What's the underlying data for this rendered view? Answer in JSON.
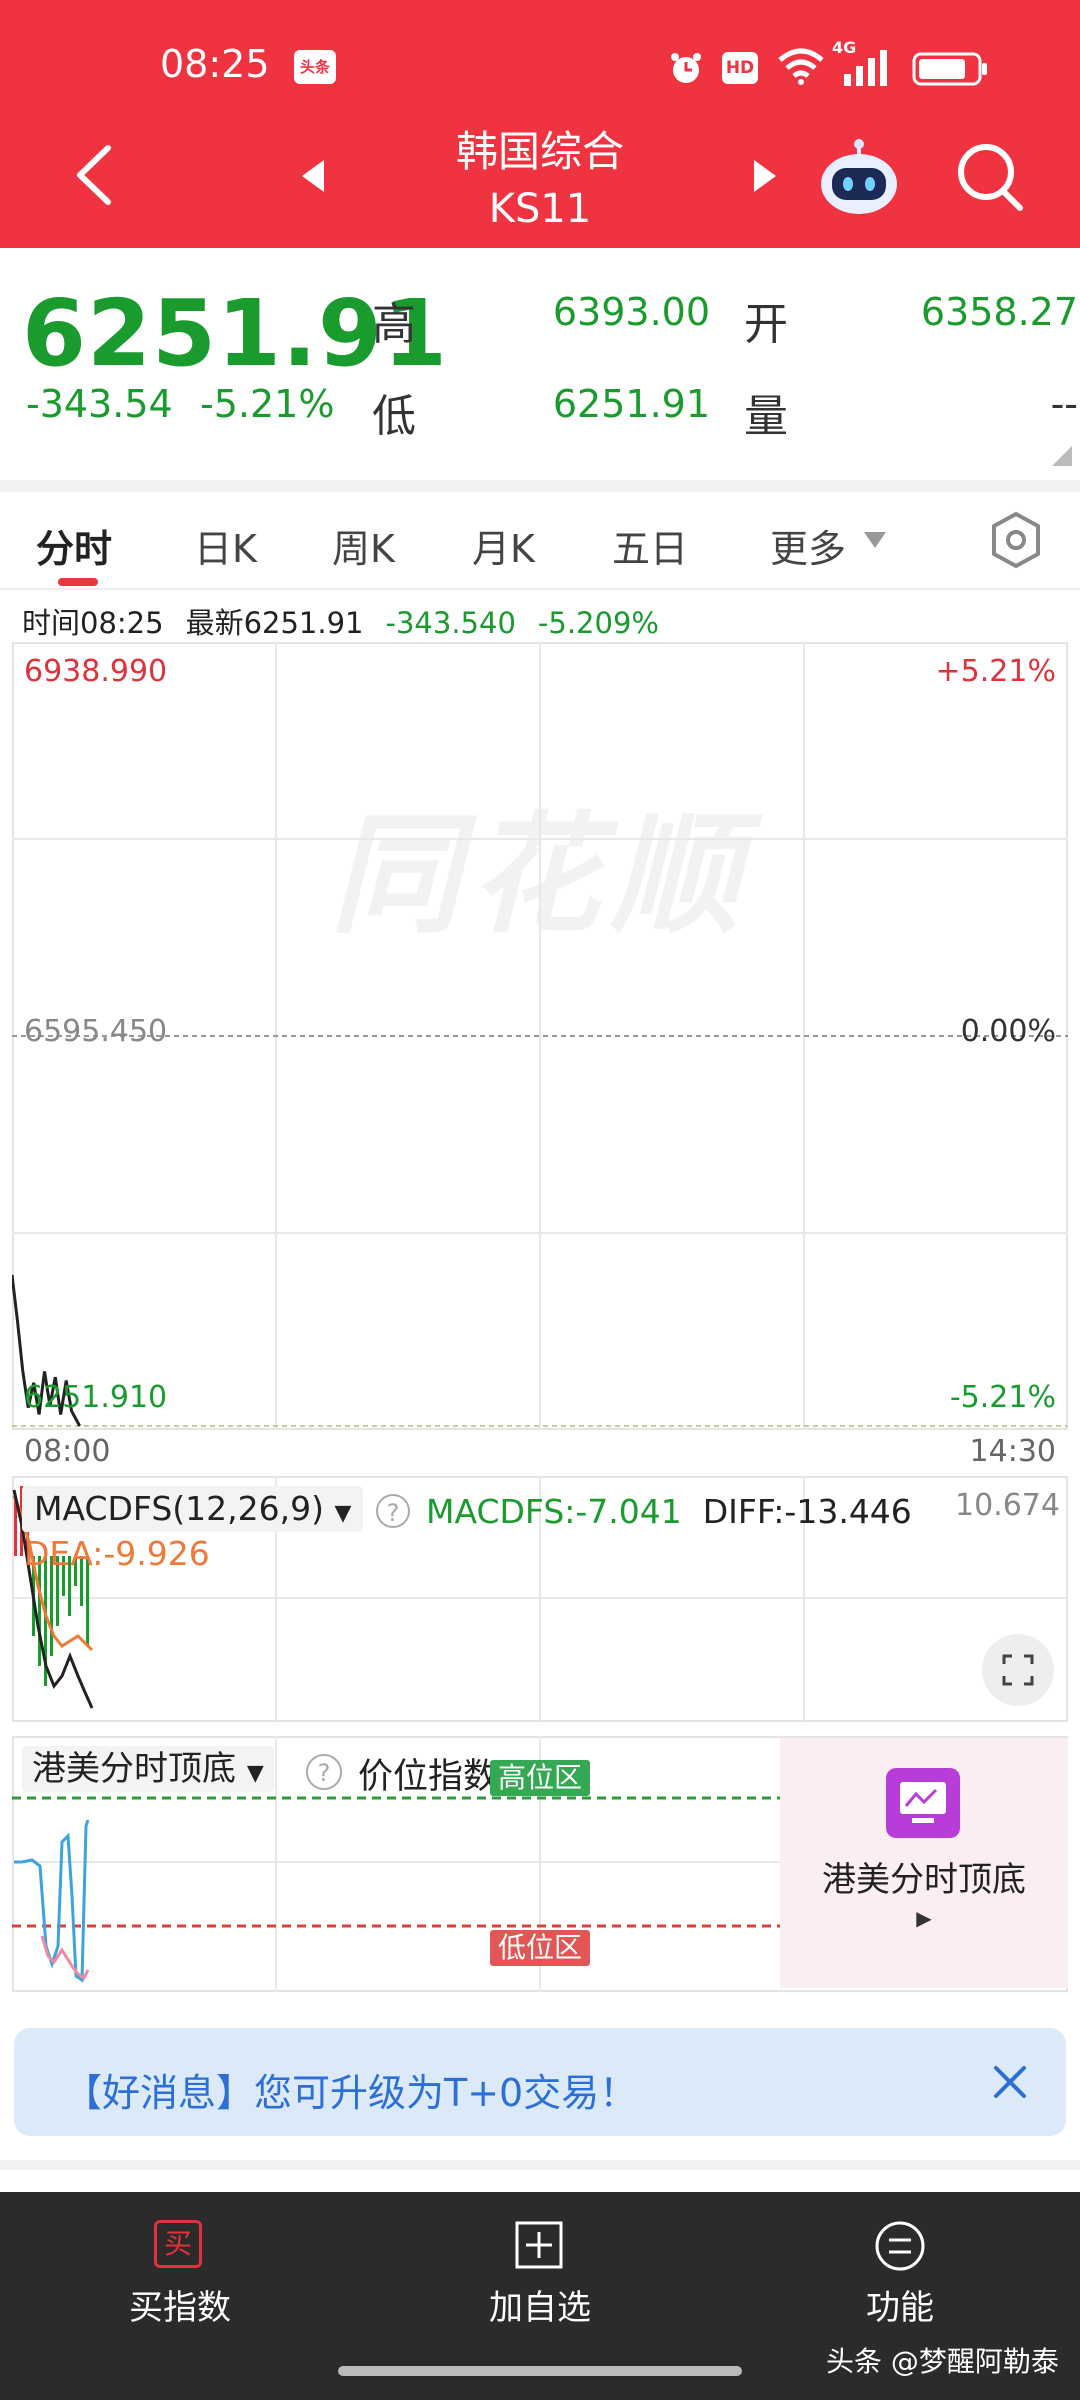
{
  "status_bar": {
    "time": "08:25",
    "badge": "头条",
    "hd": "HD",
    "network": "4G"
  },
  "header": {
    "index_name": "韩国综合",
    "index_code": "KS11"
  },
  "quote": {
    "price": "6251.91",
    "change": "-343.54",
    "change_pct": "-5.21%",
    "high_label": "高",
    "high": "6393.00",
    "open_label": "开",
    "open": "6358.27",
    "low_label": "低",
    "low": "6251.91",
    "volume_label": "量",
    "volume": "--"
  },
  "tabs": [
    "分时",
    "日K",
    "周K",
    "月K",
    "五日",
    "更多"
  ],
  "info_line": {
    "time": "时间08:25",
    "latest": "最新6251.91",
    "change": "-343.540",
    "change_pct": "-5.209%"
  },
  "chart": {
    "top_price": "6938.990",
    "top_pct": "+5.21%",
    "mid_price": "6595.450",
    "mid_pct": "0.00%",
    "bottom_price": "6251.910",
    "bottom_pct": "-5.21%",
    "start_time": "08:00",
    "end_time": "14:30",
    "watermark": "同花顺"
  },
  "chart_data": {
    "type": "line",
    "title": "",
    "x": [
      "08:00",
      "08:02",
      "08:04",
      "08:06",
      "08:08",
      "08:10",
      "08:12",
      "08:14",
      "08:16",
      "08:18",
      "08:20",
      "08:22",
      "08:25"
    ],
    "series": [
      {
        "values": [
          6385,
          6345,
          6300,
          6268,
          6290,
          6262,
          6300,
          6270,
          6295,
          6262,
          6292,
          6265,
          6251.91
        ]
      }
    ],
    "ylim": [
      6251.91,
      6938.99
    ],
    "xlim": [
      "08:00",
      "14:30"
    ],
    "grid": true
  },
  "macd": {
    "name": "MACDFS(12,26,9)",
    "macdfs": "MACDFS:-7.041",
    "diff": "DIFF:-13.446",
    "dea": "DEA:-9.926",
    "max": "10.674"
  },
  "indicator3": {
    "name": "港美分时顶底",
    "label": "价位指数:3.85",
    "high_zone": "高位区",
    "low_zone": "低位区"
  },
  "promo": {
    "title": "港美分时顶底"
  },
  "banner": {
    "text": "【好消息】您可升级为T+0交易！"
  },
  "bottom_nav": {
    "buy_icon": "买",
    "buy": "买指数",
    "add": "加自选",
    "func": "功能"
  },
  "attribution": "头条 @梦醒阿勒泰",
  "colors": {
    "header": "#ef3340",
    "down": "#1a9b2e",
    "up": "#e0323b",
    "dea": "#f07838"
  }
}
